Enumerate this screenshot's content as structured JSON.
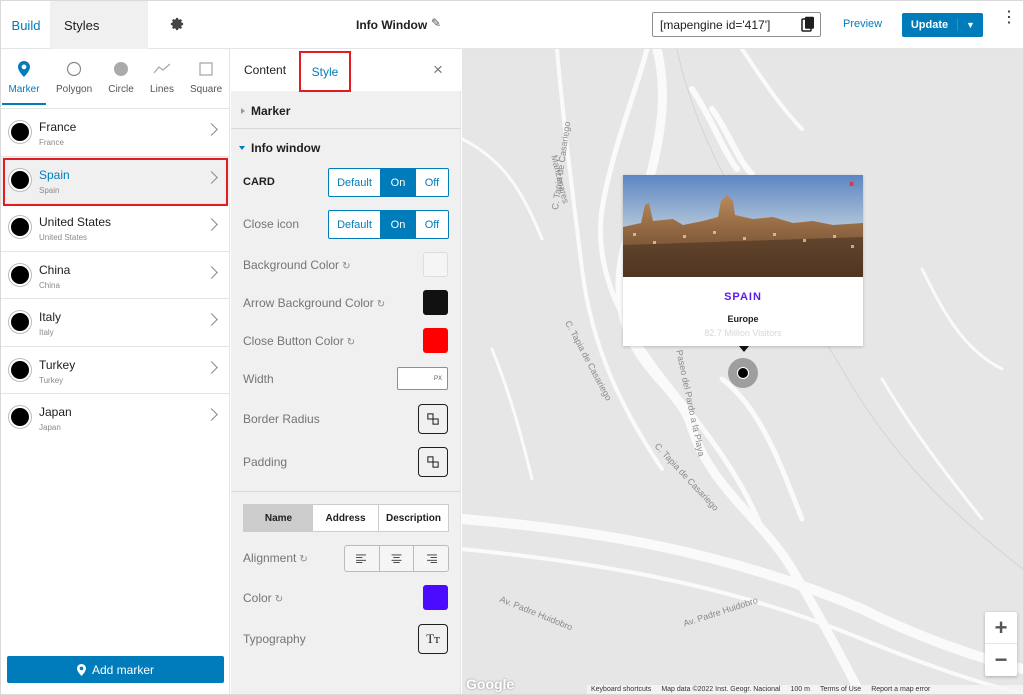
{
  "topbar": {
    "tab_build": "Build",
    "tab_styles": "Styles",
    "doc_title": "Info Window",
    "shortcode": "[mapengine id='417']",
    "preview": "Preview",
    "update": "Update",
    "accent": "#007cba"
  },
  "marker_types": [
    {
      "label": "Marker",
      "icon": "map-pin-icon"
    },
    {
      "label": "Polygon",
      "icon": "polygon-icon"
    },
    {
      "label": "Circle",
      "icon": "circle-icon"
    },
    {
      "label": "Lines",
      "icon": "lines-icon"
    },
    {
      "label": "Square",
      "icon": "square-icon"
    }
  ],
  "markers": [
    {
      "name": "France",
      "sub": "France"
    },
    {
      "name": "Spain",
      "sub": "Spain",
      "selected": true
    },
    {
      "name": "United States",
      "sub": "United States"
    },
    {
      "name": "China",
      "sub": "China"
    },
    {
      "name": "Italy",
      "sub": "Italy"
    },
    {
      "name": "Turkey",
      "sub": "Turkey"
    },
    {
      "name": "Japan",
      "sub": "Japan"
    }
  ],
  "add_marker": "Add marker",
  "panel": {
    "tab_content": "Content",
    "tab_style": "Style",
    "close": "×",
    "section_marker": "Marker",
    "section_info": "Info window",
    "card_label": "CARD",
    "close_icon_label": "Close icon",
    "seg_default": "Default",
    "seg_on": "On",
    "seg_off": "Off",
    "bg_color_label": "Background Color",
    "arrow_bg_label": "Arrow Background Color",
    "close_btn_color_label": "Close Button Color",
    "width_label": "Width",
    "width_unit": "PX",
    "border_radius_label": "Border Radius",
    "padding_label": "Padding",
    "text_tabs": [
      "Name",
      "Address",
      "Description"
    ],
    "alignment_label": "Alignment",
    "color_label": "Color",
    "typography_label": "Typography",
    "colors": {
      "background": "#f5f5f5",
      "arrow_background": "#111111",
      "close_button": "#ff0000",
      "text": "#4a0bff"
    }
  },
  "map": {
    "card_title": "SPAIN",
    "card_continent": "Europe",
    "card_visitors": "82.7 Million Visitors",
    "close_x": "×",
    "zoom_in": "+",
    "zoom_out": "−",
    "google": "Google",
    "attribution": [
      "Keyboard shortcuts",
      "Map data ©2022 Inst. Geogr. Nacional",
      "100 m",
      "Terms of Use",
      "Report a map error"
    ],
    "streets": [
      "C. Tapia de Casariego",
      "C. Tapia de Casariego",
      "C. Tapia de Casariego",
      "Av. Padre Huidobro",
      "Av. Padre Huidobro",
      "Paseo del Pardo a la Playa",
      "Manzanares"
    ]
  }
}
